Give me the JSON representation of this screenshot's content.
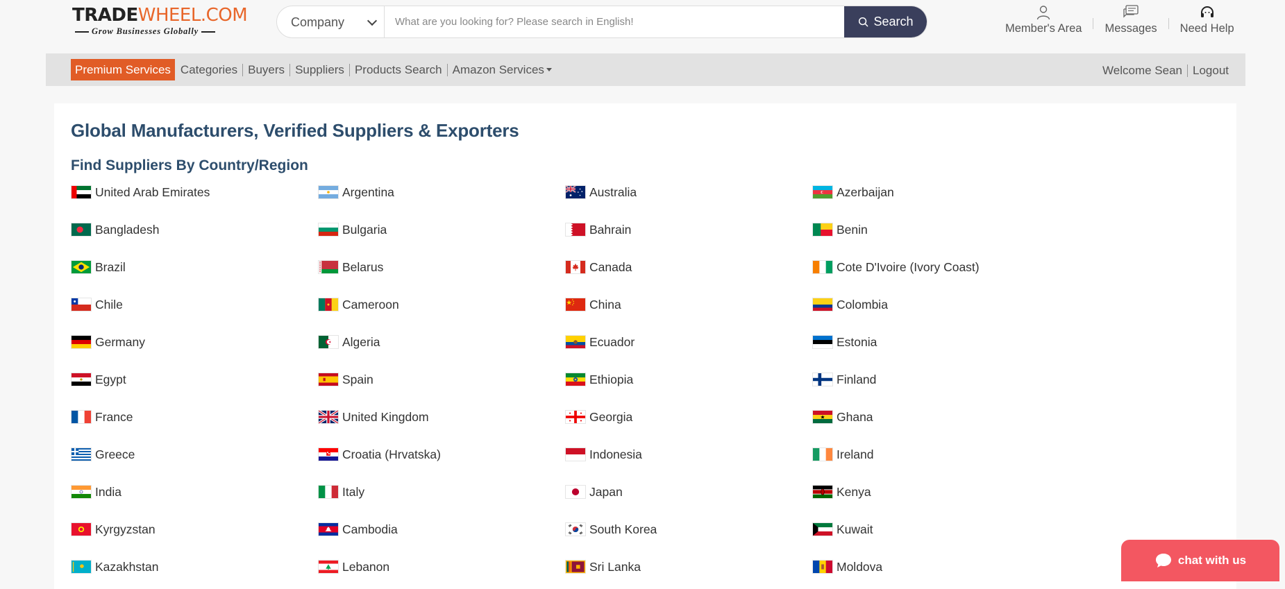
{
  "logo": {
    "part1": "TRADE",
    "part2": "WHEEL.COM",
    "tagline": "Grow Businesses Globally"
  },
  "search": {
    "type_selected": "Company",
    "placeholder": "What are you looking for? Please search in English!",
    "button_label": "Search"
  },
  "header_links": [
    {
      "icon": "user-icon",
      "label": "Member's Area"
    },
    {
      "icon": "messages-icon",
      "label": "Messages"
    },
    {
      "icon": "headset-icon",
      "label": "Need Help"
    }
  ],
  "nav": {
    "premium_label": "Premium Services",
    "items": [
      "Categories",
      "Buyers",
      "Suppliers",
      "Products Search",
      "Amazon Services"
    ],
    "welcome": "Welcome Sean",
    "logout": "Logout"
  },
  "page": {
    "title": "Global Manufacturers, Verified Suppliers & Exporters",
    "subtitle": "Find Suppliers By Country/Region"
  },
  "countries": [
    [
      "United Arab Emirates",
      "Argentina",
      "Australia",
      "Azerbaijan"
    ],
    [
      "Bangladesh",
      "Bulgaria",
      "Bahrain",
      "Benin"
    ],
    [
      "Brazil",
      "Belarus",
      "Canada",
      "Cote D'Ivoire (Ivory Coast)"
    ],
    [
      "Chile",
      "Cameroon",
      "China",
      "Colombia"
    ],
    [
      "Germany",
      "Algeria",
      "Ecuador",
      "Estonia"
    ],
    [
      "Egypt",
      "Spain",
      "Ethiopia",
      "Finland"
    ],
    [
      "France",
      "United Kingdom",
      "Georgia",
      "Ghana"
    ],
    [
      "Greece",
      "Croatia (Hrvatska)",
      "Indonesia",
      "Ireland"
    ],
    [
      "India",
      "Italy",
      "Japan",
      "Kenya"
    ],
    [
      "Kyrgyzstan",
      "Cambodia",
      "South Korea",
      "Kuwait"
    ],
    [
      "Kazakhstan",
      "Lebanon",
      "Sri Lanka",
      "Moldova"
    ]
  ],
  "chat": {
    "label": "chat with us"
  },
  "colors": {
    "accent": "#e15c26",
    "heading": "#2d4d6c",
    "search_button": "#3a3f5c",
    "chat": "#f35761"
  }
}
